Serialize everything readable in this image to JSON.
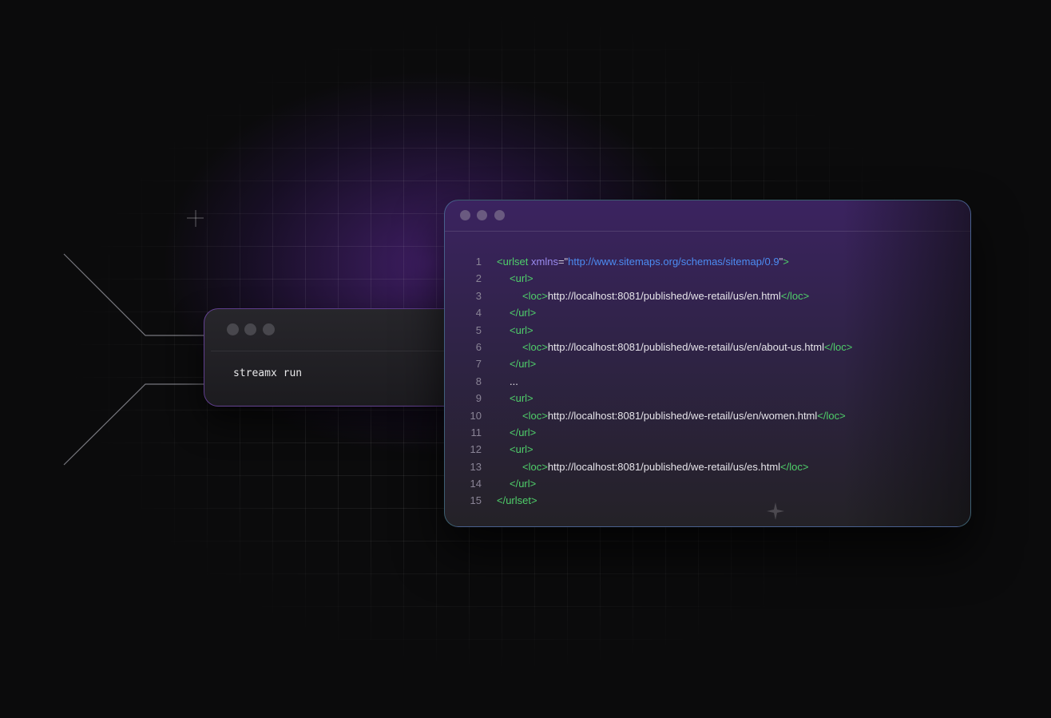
{
  "terminal": {
    "command": "streamx run"
  },
  "editor": {
    "lines": [
      {
        "n": "1",
        "indent": 0,
        "parts": [
          {
            "c": "tag",
            "t": "<urlset"
          },
          {
            "c": "attr",
            "t": " xmlns"
          },
          {
            "c": "punct",
            "t": "=\""
          },
          {
            "c": "str",
            "t": "http://www.sitemaps.org/schemas/sitemap/0.9"
          },
          {
            "c": "punct",
            "t": "\""
          },
          {
            "c": "tag",
            "t": ">"
          }
        ]
      },
      {
        "n": "2",
        "indent": 1,
        "parts": [
          {
            "c": "tag",
            "t": "<url>"
          }
        ]
      },
      {
        "n": "3",
        "indent": 2,
        "parts": [
          {
            "c": "tag",
            "t": "<loc>"
          },
          {
            "c": "txt",
            "t": "http://localhost:8081/published/we-retail/us/en.html"
          },
          {
            "c": "tag",
            "t": "</loc>"
          }
        ]
      },
      {
        "n": "4",
        "indent": 1,
        "parts": [
          {
            "c": "tag",
            "t": "</url>"
          }
        ]
      },
      {
        "n": "5",
        "indent": 1,
        "parts": [
          {
            "c": "tag",
            "t": "<url>"
          }
        ]
      },
      {
        "n": "6",
        "indent": 2,
        "parts": [
          {
            "c": "tag",
            "t": "<loc>"
          },
          {
            "c": "txt",
            "t": "http://localhost:8081/published/we-retail/us/en/about-us.html"
          },
          {
            "c": "tag",
            "t": "</loc>"
          }
        ]
      },
      {
        "n": "7",
        "indent": 1,
        "parts": [
          {
            "c": "tag",
            "t": "</url>"
          }
        ]
      },
      {
        "n": "8",
        "indent": 1,
        "parts": [
          {
            "c": "txt",
            "t": "..."
          }
        ]
      },
      {
        "n": "9",
        "indent": 1,
        "parts": [
          {
            "c": "tag",
            "t": "<url>"
          }
        ]
      },
      {
        "n": "10",
        "indent": 2,
        "parts": [
          {
            "c": "tag",
            "t": "<loc>"
          },
          {
            "c": "txt",
            "t": "http://localhost:8081/published/we-retail/us/en/women.html"
          },
          {
            "c": "tag",
            "t": "</loc>"
          }
        ]
      },
      {
        "n": "11",
        "indent": 1,
        "parts": [
          {
            "c": "tag",
            "t": "</url>"
          }
        ]
      },
      {
        "n": "12",
        "indent": 1,
        "parts": [
          {
            "c": "tag",
            "t": "<url>"
          }
        ]
      },
      {
        "n": "13",
        "indent": 2,
        "parts": [
          {
            "c": "tag",
            "t": "<loc>"
          },
          {
            "c": "txt",
            "t": "http://localhost:8081/published/we-retail/us/es.html"
          },
          {
            "c": "tag",
            "t": "</loc>"
          }
        ]
      },
      {
        "n": "14",
        "indent": 1,
        "parts": [
          {
            "c": "tag",
            "t": "</url>"
          }
        ]
      },
      {
        "n": "15",
        "indent": 0,
        "parts": [
          {
            "c": "tag",
            "t": "</urlset>"
          }
        ]
      }
    ]
  },
  "colors": {
    "tag": "#4fcf6a",
    "attr": "#9b8cf0",
    "string": "#4c8cf2",
    "text": "#e6e4ea",
    "accent": "#6b2fb0"
  },
  "icons": [
    "window-control-dot",
    "plus-marker-icon",
    "sparkle-icon"
  ]
}
